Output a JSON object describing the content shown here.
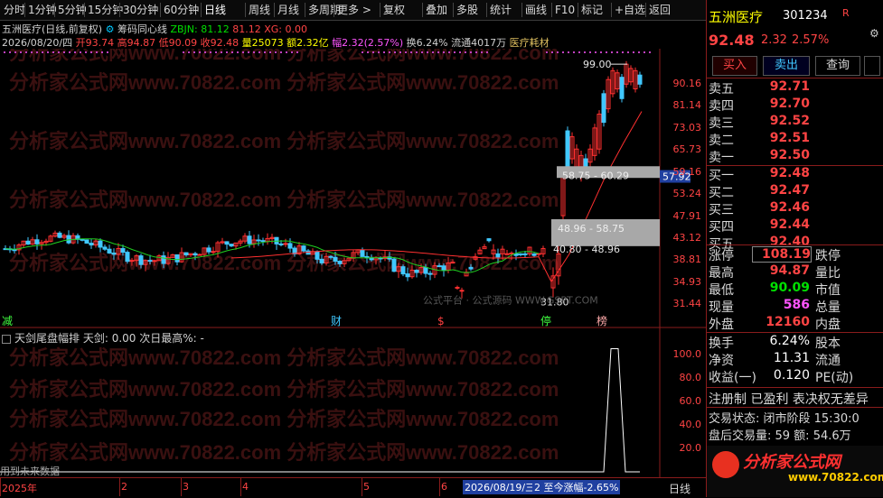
{
  "toolbar": {
    "items": [
      "分时",
      "1分钟",
      "5分钟",
      "15分钟",
      "30分钟",
      "60分钟",
      "日线",
      "周线",
      "月线",
      "多周期",
      "更多 >",
      "复权",
      "叠加",
      "多股",
      "统计",
      "画线",
      "F10",
      "标记",
      "+自选",
      "返回"
    ]
  },
  "chart_header": {
    "stock": "五洲医疗(日线,前复权)",
    "indicator": "筹码同心线",
    "zbjn": "ZBJN: 81.12",
    "v2": "81.12",
    "xg": "XG: 0.00"
  },
  "bar_info": {
    "date": "2026/08/20/四",
    "open": "开93.74",
    "high": "高94.87",
    "low": "低90.09",
    "close": "收92.48",
    "vol": "量25073",
    "amount": "额2.32亿",
    "change": "幅2.32(2.57%)",
    "turnover": "换6.24%",
    "float": "流通4017万",
    "sector": "医疗耗材"
  },
  "price_axis": [
    "90.16",
    "81.14",
    "73.03",
    "65.73",
    "59.16",
    "53.24",
    "47.91",
    "43.12",
    "38.81",
    "34.93",
    "31.44"
  ],
  "price_current": "57.92",
  "price_high_label": "99.00",
  "price_low_label": "31.80",
  "zones": [
    "58.75 - 60.29",
    "48.96 - 58.75",
    "40.80 - 48.96"
  ],
  "event_marks": {
    "jian": "减",
    "cai": "财",
    "s": "$",
    "ting": "停",
    "bang": "榜"
  },
  "watermark_site": "公式平台 · 公式源码 WWW.GSPT.COM",
  "watermark": "分析家公式网www.70822.com",
  "sub_header": {
    "title": "天剑尾盘幅排",
    "tianjian": "天剑: 0.00",
    "next": "次日最高%: -"
  },
  "sub_axis": [
    "100.0",
    "80.0",
    "60.0",
    "40.0",
    "20.0"
  ],
  "sub_note": "用到未来数据",
  "time_axis": [
    "2025年",
    "2",
    "3",
    "4",
    "5",
    "6"
  ],
  "time_cursor": "2026/08/19/三",
  "time_range": "2 至今涨幅-2.65%",
  "period_label": "日线",
  "quote": {
    "name": "五洲医疗",
    "code": "301234",
    "flag": "R",
    "price": "92.48",
    "chg": "2.32",
    "pct": "2.57%",
    "buttons": [
      "买入",
      "卖出",
      "查询"
    ],
    "sell": [
      {
        "label": "卖五",
        "price": "92.71"
      },
      {
        "label": "卖四",
        "price": "92.70"
      },
      {
        "label": "卖三",
        "price": "92.52"
      },
      {
        "label": "卖二",
        "price": "92.51"
      },
      {
        "label": "卖一",
        "price": "92.50"
      }
    ],
    "buy": [
      {
        "label": "买一",
        "price": "92.48"
      },
      {
        "label": "买二",
        "price": "92.47"
      },
      {
        "label": "买三",
        "price": "92.46"
      },
      {
        "label": "买四",
        "price": "92.44"
      },
      {
        "label": "买五",
        "price": "92.40"
      }
    ],
    "stats": [
      {
        "k": "涨停",
        "v": "108.19",
        "k2": "跌停"
      },
      {
        "k": "最高",
        "v": "94.87",
        "k2": "量比"
      },
      {
        "k": "最低",
        "v": "90.09",
        "k2": "市值"
      },
      {
        "k": "现量",
        "v": "586",
        "k2": "总量"
      },
      {
        "k": "外盘",
        "v": "12160",
        "k2": "内盘"
      }
    ],
    "fin": [
      {
        "k": "换手",
        "v": "6.24%",
        "k2": "股本"
      },
      {
        "k": "净资",
        "v": "11.31",
        "k2": "流通"
      },
      {
        "k": "收益(一)",
        "v": "0.120",
        "k2": "PE(动)"
      }
    ],
    "reg": "注册制 已盈利 表决权无差异",
    "status": "交易状态: 闭市阶段 15:30:0",
    "after": "盘后交易量: 59  额: 54.6万",
    "logo": "分析家公式网",
    "logo_url": "www.70822.com"
  },
  "chart_data": {
    "type": "candlestick",
    "price_axis_ticks": [
      90.16,
      81.14,
      73.03,
      65.73,
      59.16,
      53.24,
      47.91,
      43.12,
      38.81,
      34.93,
      31.44
    ],
    "last_close": 92.48,
    "high_mark": 99.0,
    "low_mark": 31.8,
    "chip_zones": [
      [
        58.75,
        60.29
      ],
      [
        48.96,
        58.75
      ],
      [
        40.8,
        48.96
      ]
    ],
    "sub_indicator": {
      "name": "天剑尾盘幅排",
      "value": 0.0,
      "ylim": [
        0,
        100
      ]
    }
  }
}
